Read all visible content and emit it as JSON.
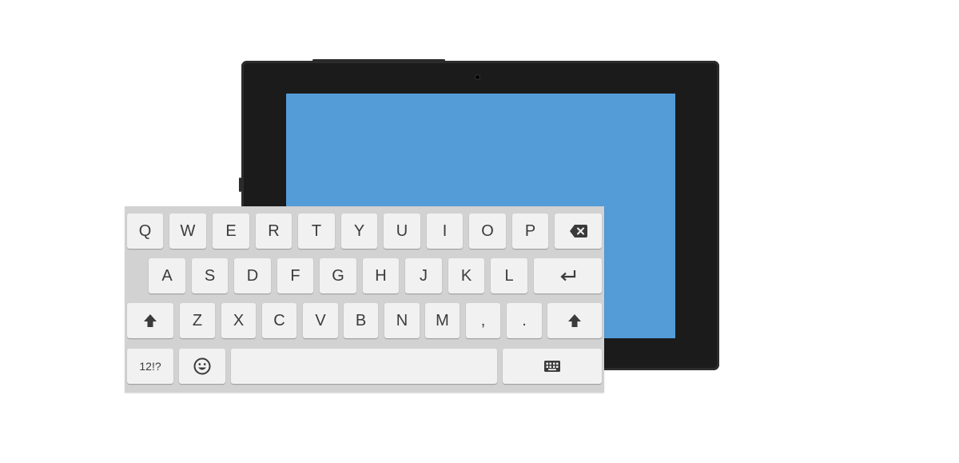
{
  "keyboard": {
    "row1": [
      "Q",
      "W",
      "E",
      "R",
      "T",
      "Y",
      "U",
      "I",
      "O",
      "P"
    ],
    "row2": [
      "A",
      "S",
      "D",
      "F",
      "G",
      "H",
      "J",
      "K",
      "L"
    ],
    "row3": [
      "Z",
      "X",
      "C",
      "V",
      "B",
      "N",
      "M",
      ",",
      "."
    ],
    "symbols_label": "12!?",
    "icons": {
      "backspace": "backspace-icon",
      "enter": "enter-icon",
      "shift": "shift-icon",
      "emoji": "emoji-icon",
      "hide_keyboard": "keyboard-hide-icon"
    }
  },
  "colors": {
    "screen": "#549cd8",
    "tablet_body": "#1b1b1b",
    "keyboard_bg": "#d2d2d2",
    "key_bg": "#f1f1f1",
    "key_text": "#3b3b3b"
  }
}
